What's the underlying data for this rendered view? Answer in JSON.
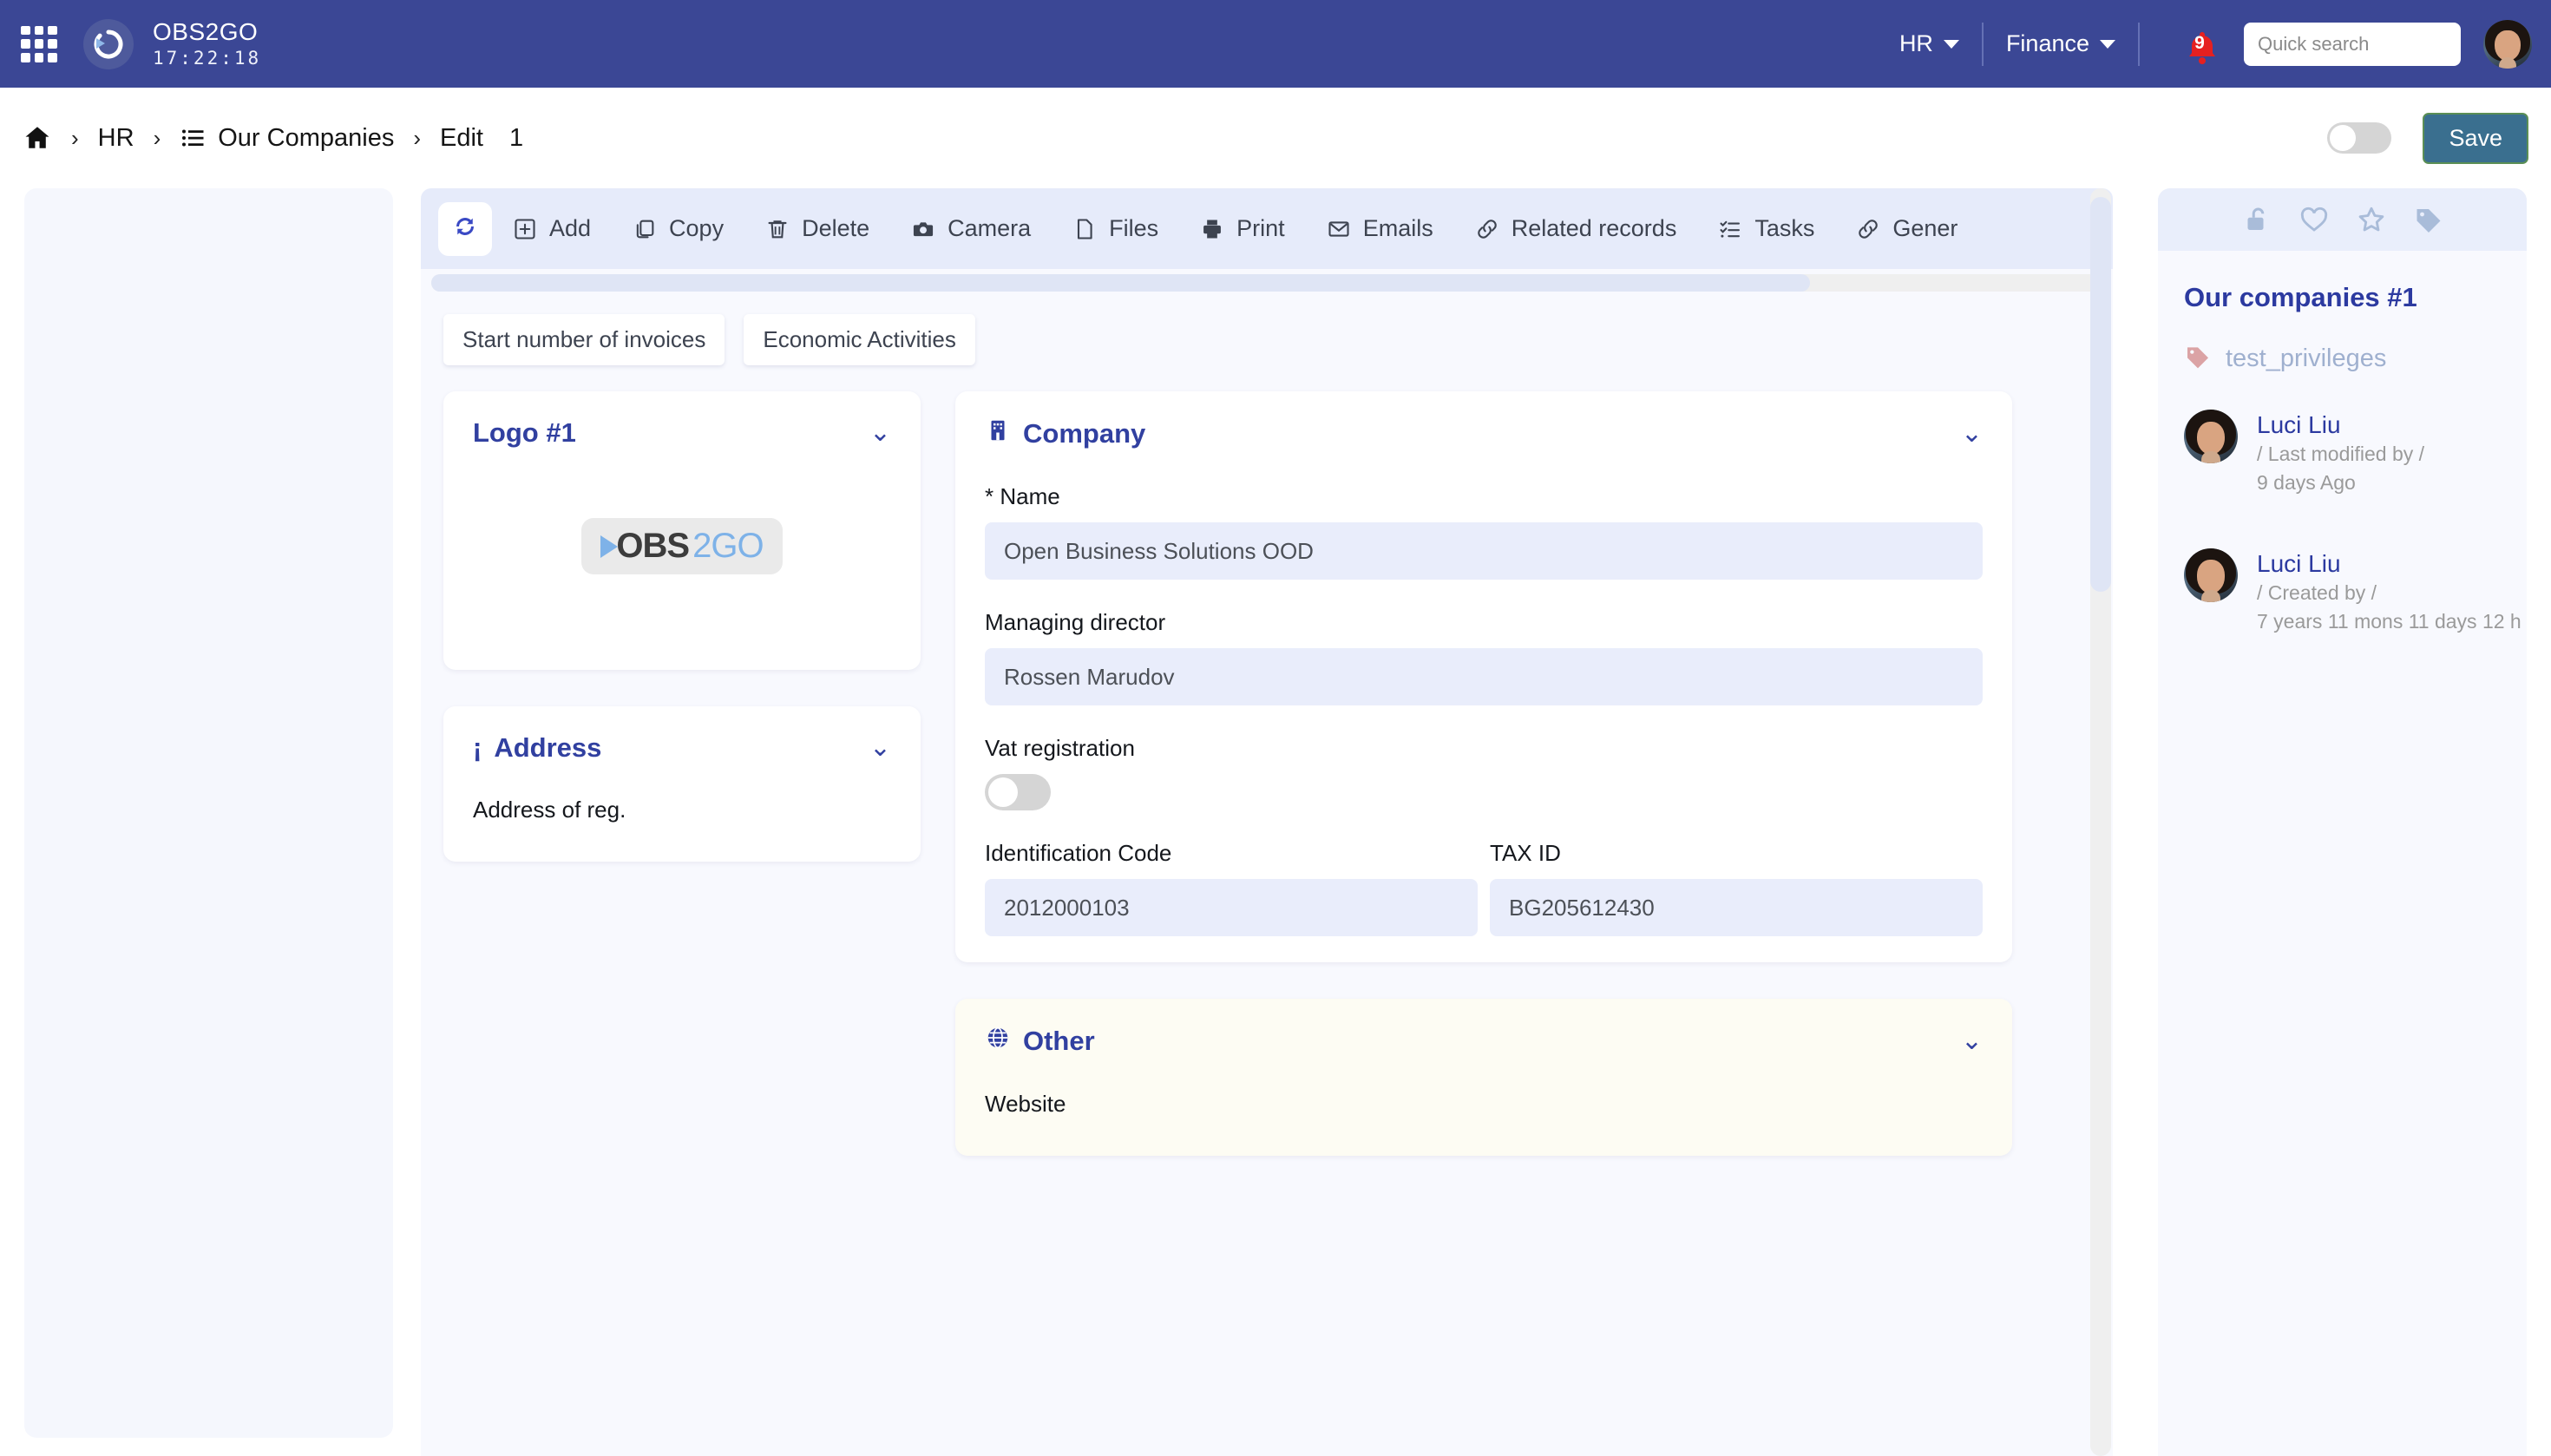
{
  "header": {
    "apps_icon": "grid-apps-icon",
    "logo_icon": "obs2go-refresh-logo-icon",
    "brand_name": "OBS2GO",
    "timer": "17:22:18",
    "menus": [
      {
        "label": "HR",
        "icon": "chevron-down-icon"
      },
      {
        "label": "Finance",
        "icon": "chevron-down-icon"
      }
    ],
    "notifications": {
      "icon": "bell-icon",
      "count": "9",
      "color": "#e62020"
    },
    "search": {
      "placeholder": "Quick search",
      "value": "",
      "icon": "search-input"
    },
    "avatar": "user-avatar"
  },
  "breadcrumb": {
    "home_icon": "home-icon",
    "items": [
      {
        "label": "HR",
        "icon": ""
      },
      {
        "label": "Our Companies",
        "icon": "list-icon"
      },
      {
        "label": "Edit",
        "icon": ""
      }
    ],
    "record_id": "1",
    "separator": "›",
    "toggle_state": "off",
    "save_label": "Save",
    "save_color": "#3a6f8f"
  },
  "toolbar": {
    "refresh_icon": "refresh-icon",
    "items": [
      {
        "label": "Add",
        "icon": "plus-square-icon"
      },
      {
        "label": "Copy",
        "icon": "copy-icon"
      },
      {
        "label": "Delete",
        "icon": "trash-icon"
      },
      {
        "label": "Camera",
        "icon": "camera-icon"
      },
      {
        "label": "Files",
        "icon": "file-icon"
      },
      {
        "label": "Print",
        "icon": "printer-icon"
      },
      {
        "label": "Emails",
        "icon": "envelope-icon"
      },
      {
        "label": "Related records",
        "icon": "link-icon"
      },
      {
        "label": "Tasks",
        "icon": "task-list-icon"
      },
      {
        "label": "Gener",
        "icon": "link-icon"
      }
    ]
  },
  "tabs": [
    {
      "label": "Start number of invoices"
    },
    {
      "label": "Economic Activities"
    }
  ],
  "cards": {
    "logo": {
      "title": "Logo #1",
      "chevron": "chevron-down-icon",
      "image_dark": "OBS",
      "image_light": "2GO"
    },
    "company": {
      "title": "Company",
      "icon": "building-icon",
      "chevron": "chevron-down-icon",
      "fields": [
        {
          "label": "* Name",
          "value": "Open Business Solutions OOD"
        },
        {
          "label": "Managing director",
          "value": "Rossen Marudov"
        }
      ],
      "vat": {
        "label": "Vat registration",
        "state": "off"
      },
      "ids": [
        {
          "label": "Identification Code",
          "value": "2012000103"
        },
        {
          "label": "TAX ID",
          "value": "BG205612430"
        }
      ]
    },
    "address": {
      "title": "Address",
      "icon": "info-icon",
      "chevron": "chevron-down-icon",
      "field_label": "Address of reg."
    },
    "other": {
      "title": "Other",
      "icon": "globe-icon",
      "chevron": "chevron-down-icon",
      "field_label": "Website"
    }
  },
  "right_panel": {
    "icons": [
      "unlock-icon",
      "heart-icon",
      "star-icon",
      "tag-icon"
    ],
    "title": "Our companies #1",
    "tag": {
      "icon": "tag-icon",
      "label": "test_privileges",
      "color": "#dba3a5"
    },
    "people": [
      {
        "name": "Luci Liu",
        "role": "/ Last modified by /",
        "time": "9 days Ago"
      },
      {
        "name": "Luci Liu",
        "role": "/ Created by /",
        "time": "7 years 11 mons 11 days 12 h"
      }
    ]
  }
}
